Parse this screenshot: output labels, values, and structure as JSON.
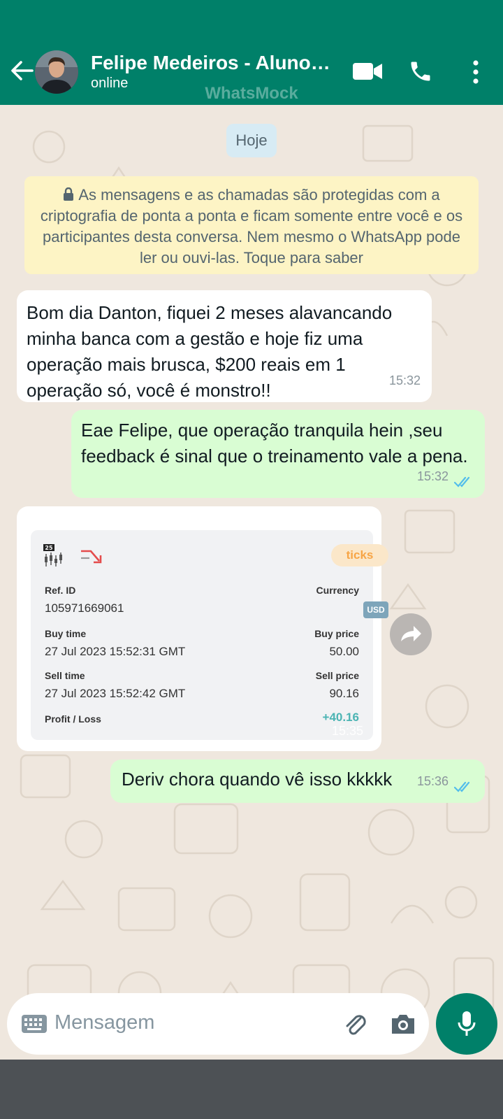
{
  "header": {
    "contact_name": "Felipe Medeiros - Aluno…",
    "status": "online",
    "watermark": "WhatsMock",
    "icons": [
      "back-arrow-icon",
      "video-call-icon",
      "phone-icon",
      "more-options-icon"
    ],
    "colors": {
      "header": "#008069",
      "chat_bg": "#efe7de",
      "outgoing_bubble": "#d9fdd3",
      "read_ticks": "#53bdeb"
    }
  },
  "chat": {
    "date_chip": "Hoje",
    "encryption_notice": "As mensagens e as chamadas são protegidas com a criptografia de ponta a ponta e ficam somente entre você e os participantes desta conversa. Nem mesmo o WhatsApp pode ler ou ouvi-las. Toque para saber",
    "messages": [
      {
        "direction": "incoming",
        "text": "Bom dia Danton, fiquei 2 meses alavancando minha banca com a gestão e hoje fiz uma operação mais brusca, $200 reais em 1 operação só, você é monstro!!",
        "time": "15:32"
      },
      {
        "direction": "outgoing",
        "text": "Eae Felipe, que operação tranquila hein ,seu feedback é sinal que o treinamento vale a pena.",
        "time": "15:32",
        "read": true
      },
      {
        "direction": "incoming",
        "type": "image",
        "time": "15:35"
      },
      {
        "direction": "outgoing",
        "text": "Deriv chora quando vê isso kkkkk",
        "time": "15:36",
        "read": true
      }
    ]
  },
  "trade_card": {
    "chart_badge": "25",
    "badge": "ticks",
    "ref_id_label": "Ref. ID",
    "ref_id": "105971669061",
    "currency_label": "Currency",
    "currency": "USD",
    "buy_time_label": "Buy time",
    "buy_time": "27 Jul 2023 15:52:31 GMT",
    "buy_price_label": "Buy price",
    "buy_price": "50.00",
    "sell_time_label": "Sell time",
    "sell_time": "27 Jul 2023 15:52:42 GMT",
    "sell_price_label": "Sell price",
    "sell_price": "90.16",
    "profit_label": "Profit / Loss",
    "profit": "+40.16",
    "profit_color": "#4bb4b3"
  },
  "composer": {
    "placeholder": "Mensagem",
    "icons": [
      "keyboard-icon",
      "attach-icon",
      "camera-icon",
      "mic-icon"
    ]
  }
}
